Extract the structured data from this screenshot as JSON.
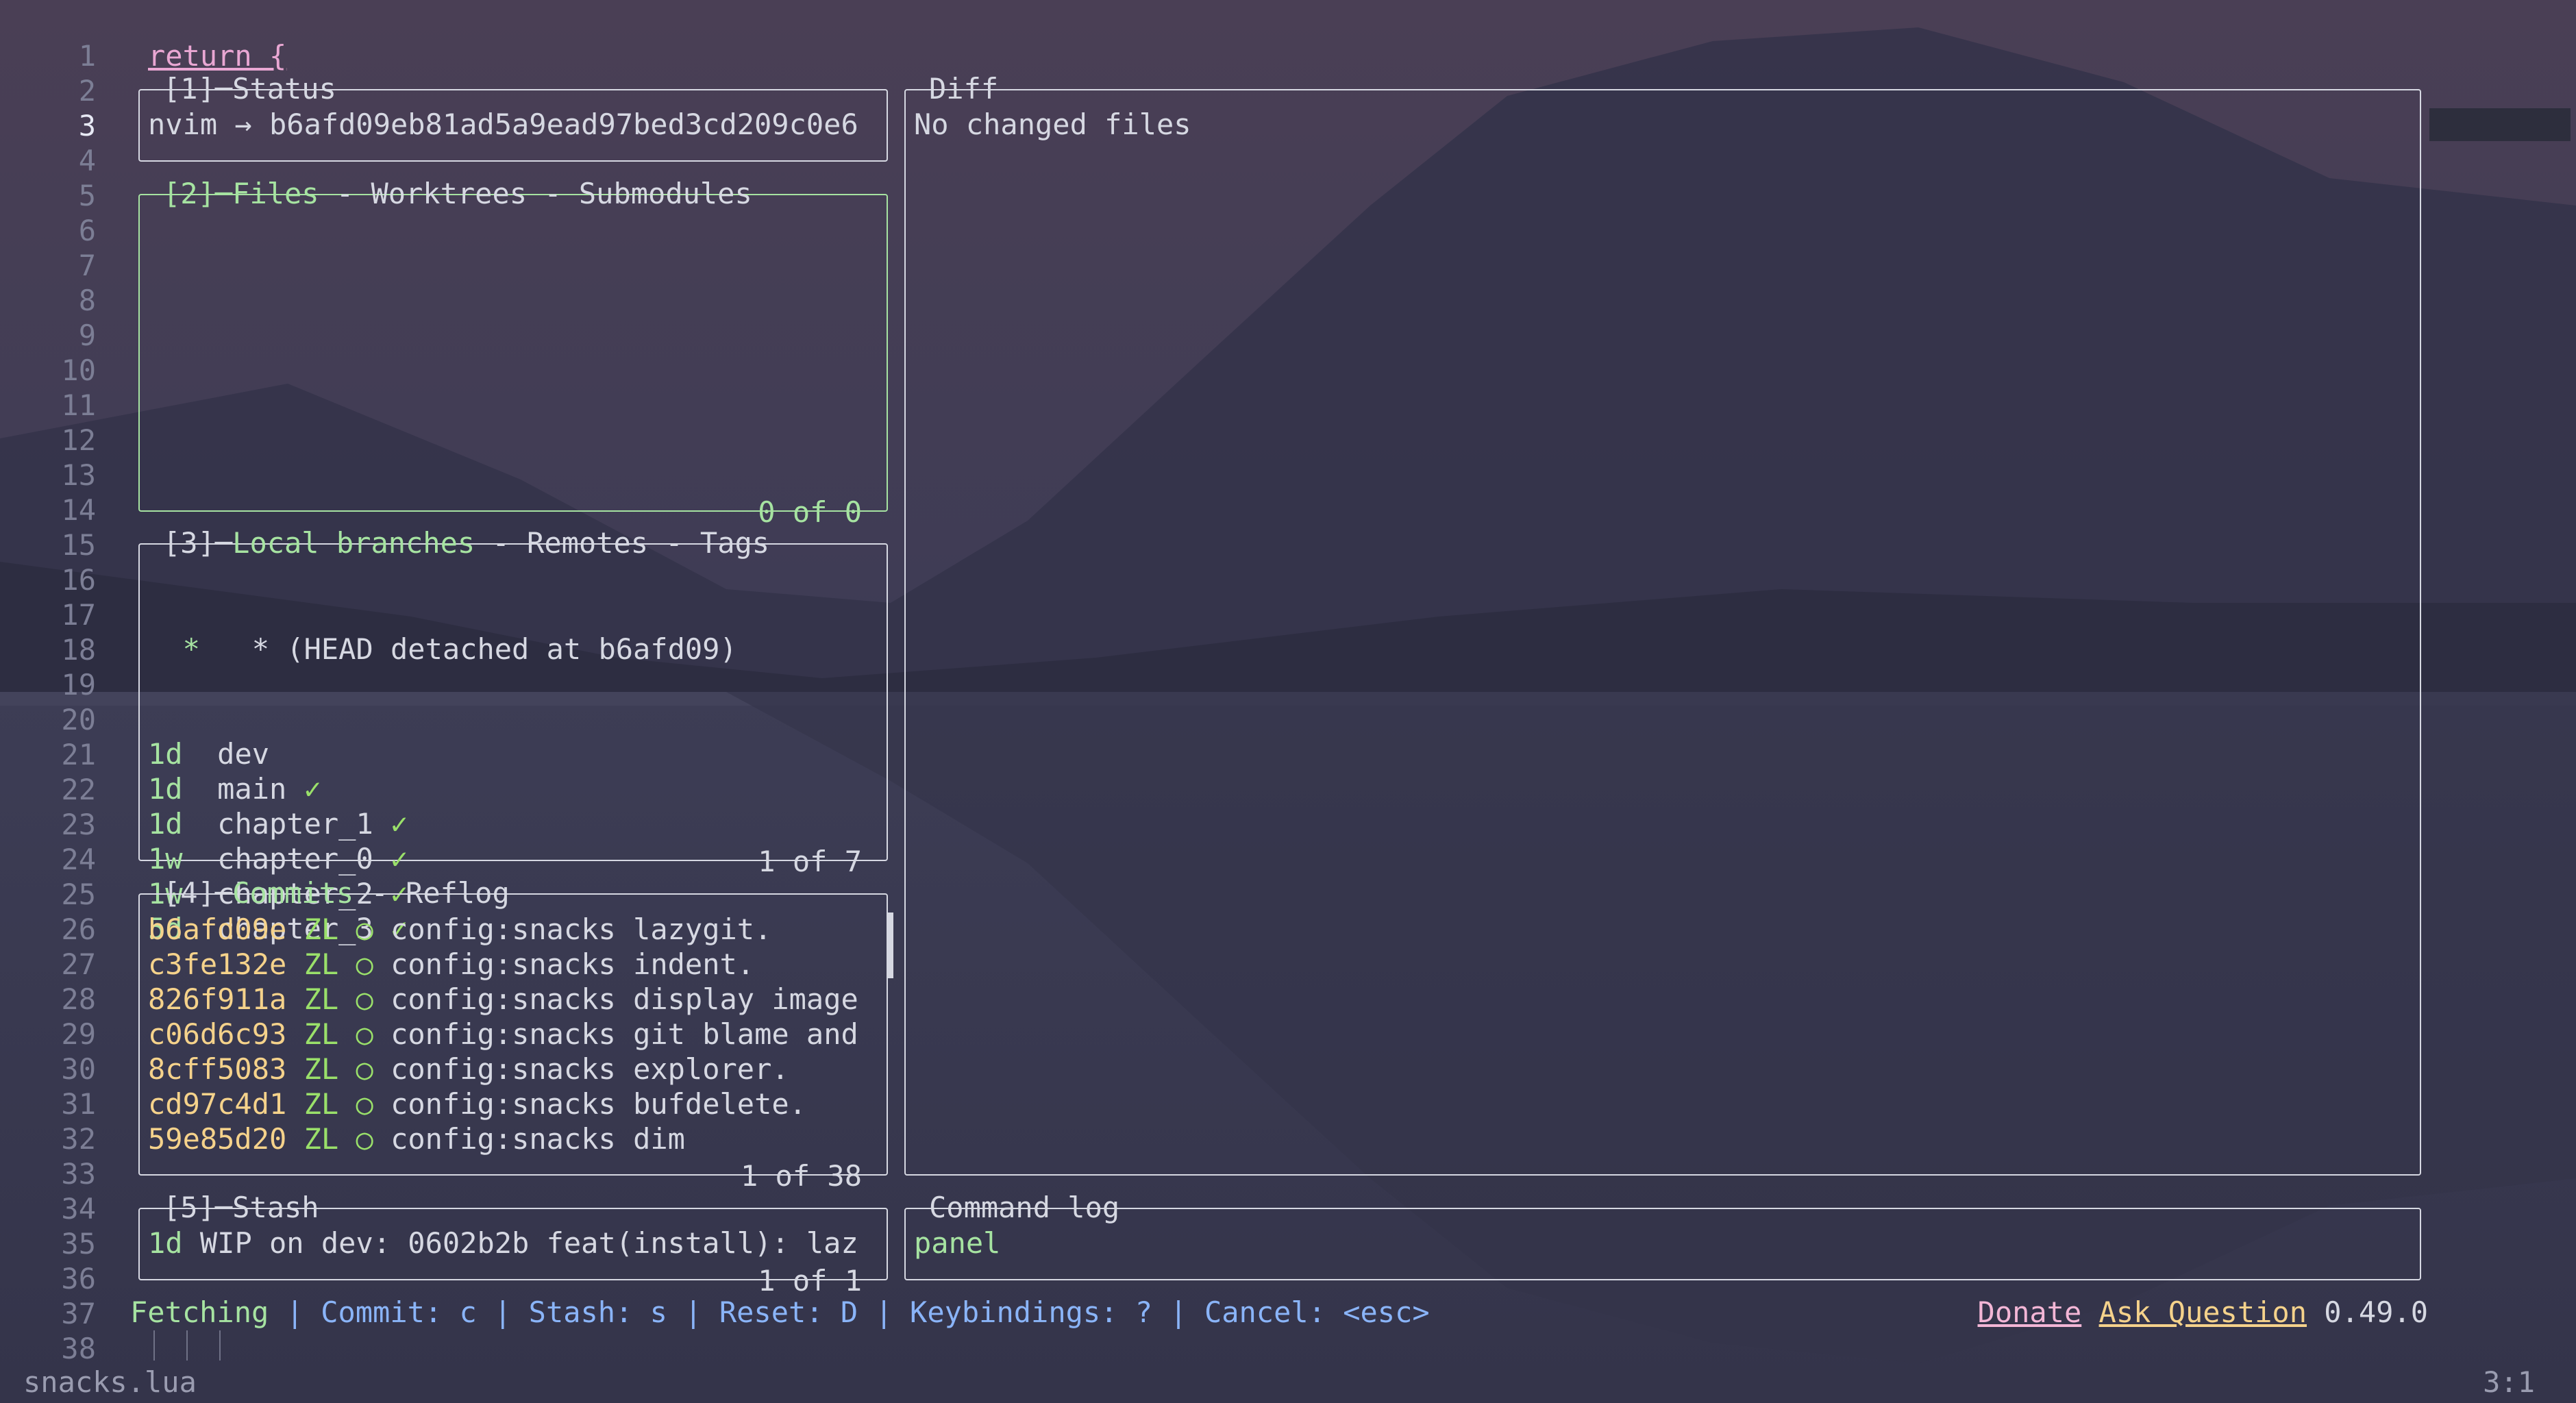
{
  "editor": {
    "first_line": "return {",
    "line_numbers": [
      "1",
      "2",
      "3",
      "4",
      "5",
      "6",
      "7",
      "8",
      "9",
      "10",
      "11",
      "12",
      "13",
      "14",
      "15",
      "16",
      "17",
      "18",
      "19",
      "20",
      "21",
      "22",
      "23",
      "24",
      "25",
      "26",
      "27",
      "28",
      "29",
      "30",
      "31",
      "32",
      "33",
      "34",
      "35",
      "36",
      "37",
      "38"
    ],
    "current_line": "3",
    "filename": "snacks.lua",
    "cursor_pos": "3:1"
  },
  "status_panel": {
    "title_num": "[1]",
    "title": "Status",
    "text": "nvim → b6afd09eb81ad5a9ead97bed3cd209c0e6"
  },
  "files_panel": {
    "title_num": "[2]",
    "tabs": [
      "Files",
      "Worktrees",
      "Submodules"
    ],
    "footer": "0 of 0"
  },
  "branches_panel": {
    "title_num": "[3]",
    "tabs": [
      "Local branches",
      "Remotes",
      "Tags"
    ],
    "head": "  * (HEAD detached at b6afd09)",
    "branches": [
      {
        "age": "1d",
        "name": "dev",
        "mark": ""
      },
      {
        "age": "1d",
        "name": "main",
        "mark": "✓"
      },
      {
        "age": "1d",
        "name": "chapter_1",
        "mark": "✓"
      },
      {
        "age": "1w",
        "name": "chapter_0",
        "mark": "✓"
      },
      {
        "age": "1w",
        "name": "chapter_2",
        "mark": "✓"
      },
      {
        "age": "5d",
        "name": "chapter_3",
        "mark": "✓"
      }
    ],
    "footer": "1 of 7"
  },
  "commits_panel": {
    "title_num": "[4]",
    "tabs": [
      "Commits",
      "Reflog"
    ],
    "commits": [
      {
        "hash": "b6afd09e",
        "author": "ZL",
        "msg": "config:snacks lazygit."
      },
      {
        "hash": "c3fe132e",
        "author": "ZL",
        "msg": "config:snacks indent."
      },
      {
        "hash": "826f911a",
        "author": "ZL",
        "msg": "config:snacks display image"
      },
      {
        "hash": "c06d6c93",
        "author": "ZL",
        "msg": "config:snacks git blame and"
      },
      {
        "hash": "8cff5083",
        "author": "ZL",
        "msg": "config:snacks explorer."
      },
      {
        "hash": "cd97c4d1",
        "author": "ZL",
        "msg": "config:snacks bufdelete."
      },
      {
        "hash": "59e85d20",
        "author": "ZL",
        "msg": "config:snacks dim"
      }
    ],
    "graph_glyph": "○",
    "footer": "1 of 38"
  },
  "stash_panel": {
    "title_num": "[5]",
    "title": "Stash",
    "entry_age": "1d",
    "entry_text": "WIP on dev: 0602b2b feat(install): laz",
    "footer": "1 of 1"
  },
  "diff_panel": {
    "title": "Diff",
    "text": "No changed files"
  },
  "command_log_panel": {
    "title": "Command log",
    "text": "panel"
  },
  "status_bar": {
    "fetching": "Fetching",
    "items": [
      "Commit: c",
      "Stash: s",
      "Reset: D",
      "Keybindings: ?",
      "Cancel: <esc>"
    ],
    "separator": "|",
    "donate": "Donate",
    "ask": "Ask Question",
    "version": "0.49.0"
  },
  "colors": {
    "active_border": "#a6e3a1",
    "hash": "#f5d28b",
    "accent_blue": "#8ab4f8",
    "green": "#a6e3a1"
  }
}
